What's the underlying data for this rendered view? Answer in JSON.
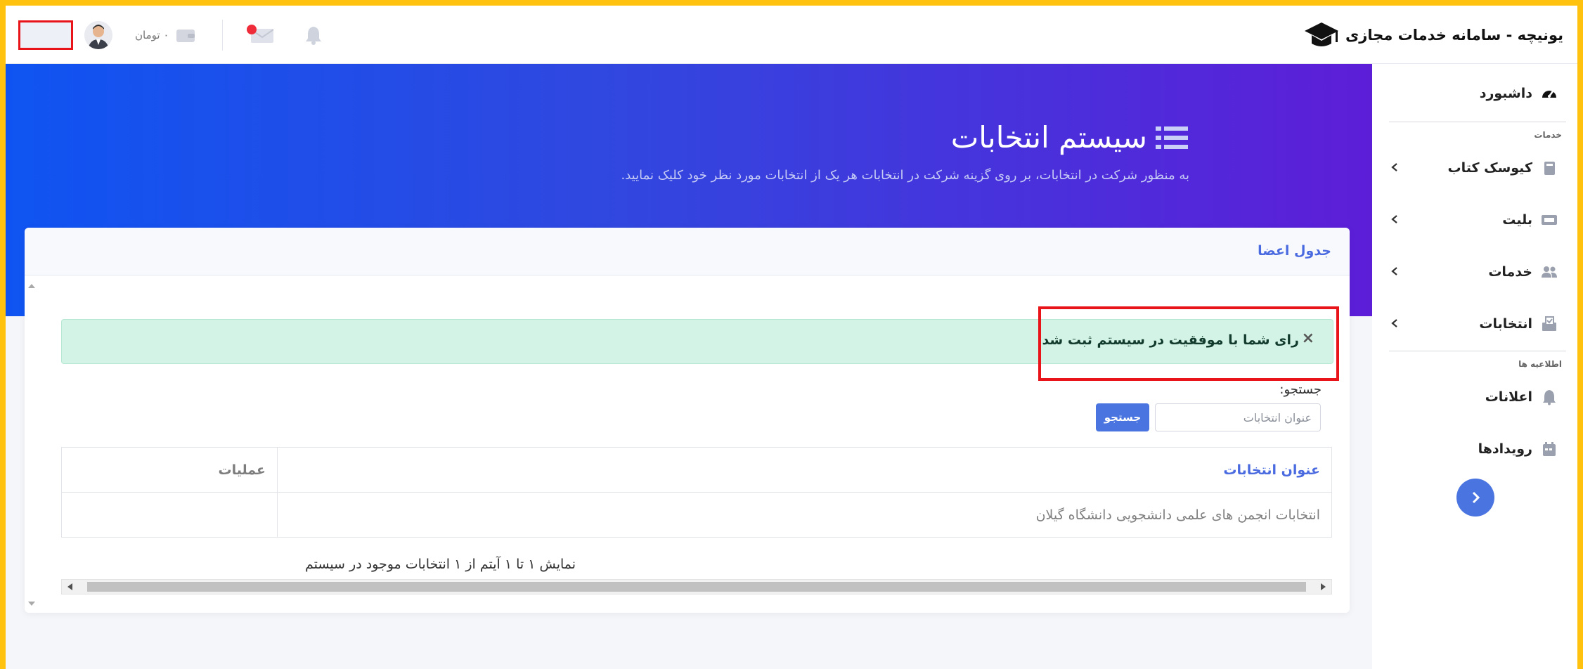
{
  "brand": {
    "title": "یونیچه - سامانه خدمات مجازی"
  },
  "topbar": {
    "wallet_amount": "۰ تومان",
    "icons": [
      "graduation-cap-icon",
      "wallet-icon",
      "mail-icon",
      "bell-icon"
    ]
  },
  "hero": {
    "title": "سیستم انتخابات",
    "subtitle": "به منظور شرکت در انتخابات، بر روی گزینه شرکت در انتخابات هر یک از انتخابات مورد نظر خود کلیک نمایید."
  },
  "card": {
    "title": "جدول اعضا",
    "alert": {
      "close": "×",
      "message": "رای شما با موفقیت در سیستم ثبت شد."
    },
    "search": {
      "label": "جستجو:",
      "placeholder": "عنوان انتخابات",
      "button": "جستجو"
    },
    "table": {
      "columns": [
        "عنوان انتخابات",
        "عملیات"
      ],
      "rows": [
        {
          "title": "انتخابات انجمن های علمی دانشجویی دانشگاه گیلان",
          "ops": ""
        }
      ]
    },
    "pagination_info": "نمایش ۱ تا ۱ آیتم از ۱ انتخابات موجود در سیستم"
  },
  "sidebar": {
    "dashboard": "داشبورد",
    "section_services": "خدمات",
    "items": [
      {
        "label": "کیوسک کتاب",
        "icon": "book-icon"
      },
      {
        "label": "بلیت",
        "icon": "ticket-icon"
      },
      {
        "label": "خدمات",
        "icon": "users-icon"
      },
      {
        "label": "انتخابات",
        "icon": "vote-icon"
      }
    ],
    "section_info": "اطلاعیه ها",
    "info_items": [
      {
        "label": "اعلانات",
        "icon": "bell-icon"
      },
      {
        "label": "رویدادها",
        "icon": "calendar-icon"
      }
    ]
  },
  "colors": {
    "accent": "#4a74e0",
    "hero_start": "#0f54f2",
    "hero_end": "#5d1ed8",
    "alert_bg": "#d2f3e5",
    "highlight": "#e8141a",
    "frame": "#ffc20e"
  }
}
